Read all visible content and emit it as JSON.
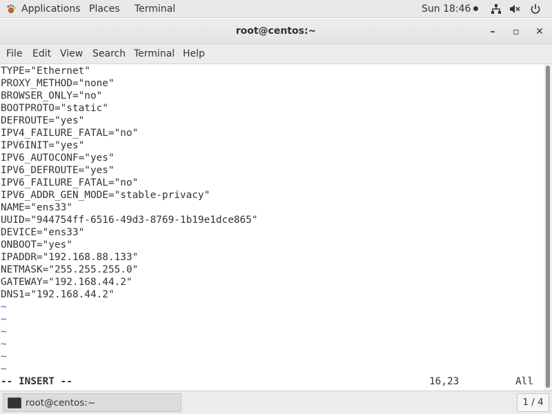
{
  "topbar": {
    "applications_label": "Applications",
    "places_label": "Places",
    "terminal_label": "Terminal",
    "clock": "Sun 18:46"
  },
  "window": {
    "title": "root@centos:~",
    "minimize_symbol": "–",
    "maximize_symbol": "▫",
    "close_symbol": "✕"
  },
  "menu": {
    "items": [
      "File",
      "Edit",
      "View",
      "Search",
      "Terminal",
      "Help"
    ]
  },
  "terminal": {
    "lines": [
      "TYPE=\"Ethernet\"",
      "PROXY_METHOD=\"none\"",
      "BROWSER_ONLY=\"no\"",
      "BOOTPROTO=\"static\"",
      "DEFROUTE=\"yes\"",
      "IPV4_FAILURE_FATAL=\"no\"",
      "IPV6INIT=\"yes\"",
      "IPV6_AUTOCONF=\"yes\"",
      "IPV6_DEFROUTE=\"yes\"",
      "IPV6_FAILURE_FATAL=\"no\"",
      "IPV6_ADDR_GEN_MODE=\"stable-privacy\"",
      "NAME=\"ens33\"",
      "UUID=\"944754ff-6516-49d3-8769-1b19e1dce865\"",
      "DEVICE=\"ens33\"",
      "ONBOOT=\"yes\"",
      "IPADDR=\"192.168.88.133\"",
      "NETMASK=\"255.255.255.0\"",
      "GATEWAY=\"192.168.44.2\"",
      "DNS1=\"192.168.44.2\""
    ],
    "tildes": [
      "~",
      "~",
      "~",
      "~",
      "~",
      "~"
    ],
    "status": {
      "mode": "-- INSERT --",
      "cursor": "16,23",
      "scroll": "All"
    }
  },
  "taskbar": {
    "window_label": "root@centos:~",
    "workspace": "1 / 4"
  },
  "colors": {
    "tilde": "#3465a4",
    "text": "#2e3436",
    "topbar_bg": "#e8e8e7"
  }
}
